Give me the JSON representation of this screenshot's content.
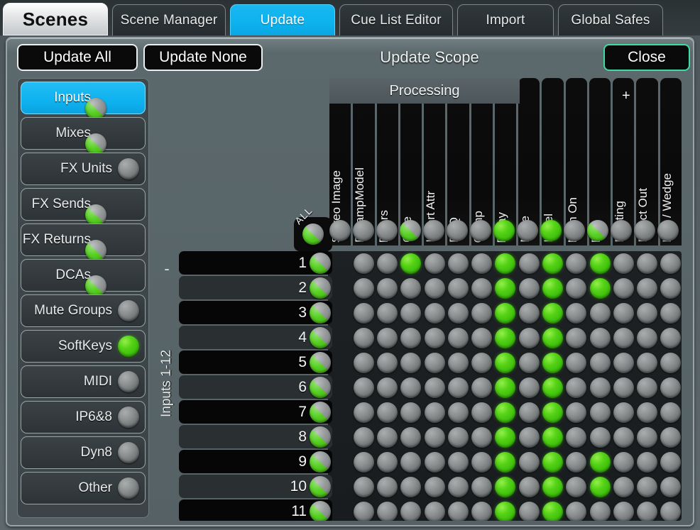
{
  "tabs": [
    {
      "label": "Scenes",
      "style": "home",
      "name": "tab-scenes"
    },
    {
      "label": "Scene Manager",
      "style": "normal",
      "name": "tab-scene-manager"
    },
    {
      "label": "Update",
      "style": "active",
      "name": "tab-update"
    },
    {
      "label": "Cue List Editor",
      "style": "normal",
      "name": "tab-cue-list-editor"
    },
    {
      "label": "Import",
      "style": "normal",
      "name": "tab-import"
    },
    {
      "label": "Global Safes",
      "style": "normal",
      "name": "tab-global-safes"
    }
  ],
  "toolbar": {
    "update_all_label": "Update All",
    "update_none_label": "Update None",
    "title": "Update Scope",
    "close_label": "Close"
  },
  "sidebar": {
    "items": [
      {
        "label": "Inputs",
        "state": "half",
        "selected": true
      },
      {
        "label": "Mixes",
        "state": "half",
        "selected": false
      },
      {
        "label": "FX Units",
        "state": "off",
        "selected": false
      },
      {
        "label": "FX Sends",
        "state": "half",
        "selected": false
      },
      {
        "label": "FX Returns",
        "state": "half",
        "selected": false
      },
      {
        "label": "DCAs",
        "state": "half",
        "selected": false
      },
      {
        "label": "Mute Groups",
        "state": "off",
        "selected": false
      },
      {
        "label": "SoftKeys",
        "state": "on",
        "selected": false
      },
      {
        "label": "MIDI",
        "state": "off",
        "selected": false
      },
      {
        "label": "IP6&8",
        "state": "off",
        "selected": false
      },
      {
        "label": "Dyn8",
        "state": "off",
        "selected": false
      },
      {
        "label": "Other",
        "state": "off",
        "selected": false
      }
    ]
  },
  "grid": {
    "group_label": "Inputs 1-12",
    "collapse_label": "-",
    "plus_label": "+",
    "processing_band_label": "Processing",
    "all_label": "ALL",
    "columns": [
      "Stereo Image",
      "PreampModel",
      "Filters",
      "Gate",
      "Insert Attr",
      "PEQ",
      "Comp",
      "Delay",
      "Mute",
      "Level",
      "Main On",
      "Pan",
      "Routing",
      "Direct Out",
      "IEM / Wedge"
    ],
    "all_row_states": [
      "off",
      "off",
      "off",
      "half",
      "off",
      "off",
      "off",
      "on",
      "off",
      "on",
      "off",
      "half",
      "off",
      "off",
      "off"
    ],
    "all_row_led": "half",
    "rows": [
      {
        "label": "1",
        "led": "half",
        "states": [
          "none",
          "off",
          "off",
          "on",
          "off",
          "off",
          "off",
          "on",
          "off",
          "on",
          "off",
          "on",
          "off",
          "off",
          "off"
        ]
      },
      {
        "label": "2",
        "led": "half",
        "states": [
          "none",
          "off",
          "off",
          "off",
          "off",
          "off",
          "off",
          "on",
          "off",
          "on",
          "off",
          "on",
          "off",
          "off",
          "off"
        ]
      },
      {
        "label": "3",
        "led": "half",
        "states": [
          "none",
          "off",
          "off",
          "off",
          "off",
          "off",
          "off",
          "on",
          "off",
          "on",
          "off",
          "off",
          "off",
          "off",
          "off"
        ]
      },
      {
        "label": "4",
        "led": "half",
        "states": [
          "none",
          "off",
          "off",
          "off",
          "off",
          "off",
          "off",
          "on",
          "off",
          "on",
          "off",
          "off",
          "off",
          "off",
          "off"
        ]
      },
      {
        "label": "5",
        "led": "half",
        "states": [
          "none",
          "off",
          "off",
          "off",
          "off",
          "off",
          "off",
          "on",
          "off",
          "on",
          "off",
          "off",
          "off",
          "off",
          "off"
        ]
      },
      {
        "label": "6",
        "led": "half",
        "states": [
          "none",
          "off",
          "off",
          "off",
          "off",
          "off",
          "off",
          "on",
          "off",
          "on",
          "off",
          "off",
          "off",
          "off",
          "off"
        ]
      },
      {
        "label": "7",
        "led": "half",
        "states": [
          "none",
          "off",
          "off",
          "off",
          "off",
          "off",
          "off",
          "on",
          "off",
          "on",
          "off",
          "off",
          "off",
          "off",
          "off"
        ]
      },
      {
        "label": "8",
        "led": "half",
        "states": [
          "none",
          "off",
          "off",
          "off",
          "off",
          "off",
          "off",
          "on",
          "off",
          "on",
          "off",
          "off",
          "off",
          "off",
          "off"
        ]
      },
      {
        "label": "9",
        "led": "half",
        "states": [
          "none",
          "off",
          "off",
          "off",
          "off",
          "off",
          "off",
          "on",
          "off",
          "on",
          "off",
          "on",
          "off",
          "off",
          "off"
        ]
      },
      {
        "label": "10",
        "led": "half",
        "states": [
          "none",
          "off",
          "off",
          "off",
          "off",
          "off",
          "off",
          "on",
          "off",
          "on",
          "off",
          "on",
          "off",
          "off",
          "off"
        ]
      },
      {
        "label": "11",
        "led": "half",
        "states": [
          "none",
          "off",
          "off",
          "off",
          "off",
          "off",
          "off",
          "on",
          "off",
          "on",
          "off",
          "off",
          "off",
          "off",
          "off"
        ]
      }
    ]
  },
  "colors": {
    "accent_blue": "#0eb2ef",
    "led_green": "#49cc10",
    "led_gray": "#8c9090",
    "close_border": "#3ddca0",
    "panel_bg": "#556165"
  }
}
